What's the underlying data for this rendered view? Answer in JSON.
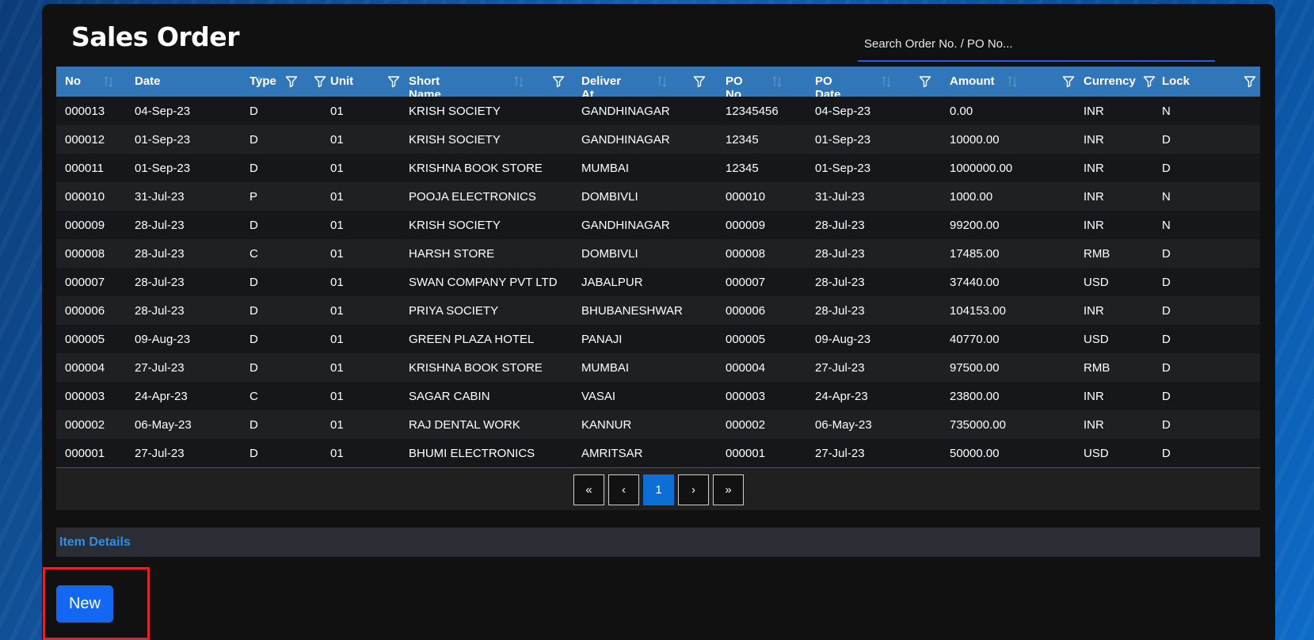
{
  "page": {
    "title": "Sales Order"
  },
  "search": {
    "placeholder": "Search Order No. / PO No..."
  },
  "table": {
    "columns": [
      {
        "key": "no",
        "label": "No",
        "sortable": true,
        "filterable": false
      },
      {
        "key": "date",
        "label": "Date",
        "sortable": true,
        "filterable": true
      },
      {
        "key": "type",
        "label": "Type",
        "sortable": false,
        "filterable": true
      },
      {
        "key": "unit",
        "label": "Unit",
        "sortable": false,
        "filterable": true
      },
      {
        "key": "short_name",
        "label": "Short Name",
        "sortable": true,
        "filterable": true
      },
      {
        "key": "deliver_at",
        "label": "Deliver At",
        "sortable": true,
        "filterable": true
      },
      {
        "key": "po_no",
        "label": "PO No",
        "sortable": true,
        "filterable": false
      },
      {
        "key": "po_date",
        "label": "PO Date",
        "sortable": true,
        "filterable": true
      },
      {
        "key": "amount",
        "label": "Amount",
        "sortable": true,
        "filterable": true
      },
      {
        "key": "currency",
        "label": "Currency",
        "sortable": false,
        "filterable": true
      },
      {
        "key": "lock",
        "label": "Lock",
        "sortable": false,
        "filterable": true
      }
    ],
    "rows": [
      [
        "000013",
        "04-Sep-23",
        "D",
        "01",
        "KRISH SOCIETY",
        "GANDHINAGAR",
        "12345456",
        "04-Sep-23",
        "0.00",
        "INR",
        "N"
      ],
      [
        "000012",
        "01-Sep-23",
        "D",
        "01",
        "KRISH SOCIETY",
        "GANDHINAGAR",
        "12345",
        "01-Sep-23",
        "10000.00",
        "INR",
        "D"
      ],
      [
        "000011",
        "01-Sep-23",
        "D",
        "01",
        "KRISHNA BOOK STORE",
        "MUMBAI",
        "12345",
        "01-Sep-23",
        "1000000.00",
        "INR",
        "D"
      ],
      [
        "000010",
        "31-Jul-23",
        "P",
        "01",
        "POOJA ELECTRONICS",
        "DOMBIVLI",
        "000010",
        "31-Jul-23",
        "1000.00",
        "INR",
        "N"
      ],
      [
        "000009",
        "28-Jul-23",
        "D",
        "01",
        "KRISH SOCIETY",
        "GANDHINAGAR",
        "000009",
        "28-Jul-23",
        "99200.00",
        "INR",
        "N"
      ],
      [
        "000008",
        "28-Jul-23",
        "C",
        "01",
        "HARSH STORE",
        "DOMBIVLI",
        "000008",
        "28-Jul-23",
        "17485.00",
        "RMB",
        "D"
      ],
      [
        "000007",
        "28-Jul-23",
        "D",
        "01",
        "SWAN COMPANY PVT LTD",
        "JABALPUR",
        "000007",
        "28-Jul-23",
        "37440.00",
        "USD",
        "D"
      ],
      [
        "000006",
        "28-Jul-23",
        "D",
        "01",
        "PRIYA SOCIETY",
        "BHUBANESHWAR",
        "000006",
        "28-Jul-23",
        "104153.00",
        "INR",
        "D"
      ],
      [
        "000005",
        "09-Aug-23",
        "D",
        "01",
        "GREEN PLAZA HOTEL",
        "PANAJI",
        "000005",
        "09-Aug-23",
        "40770.00",
        "USD",
        "D"
      ],
      [
        "000004",
        "27-Jul-23",
        "D",
        "01",
        "KRISHNA BOOK STORE",
        "MUMBAI",
        "000004",
        "27-Jul-23",
        "97500.00",
        "RMB",
        "D"
      ],
      [
        "000003",
        "24-Apr-23",
        "C",
        "01",
        "SAGAR CABIN",
        "VASAI",
        "000003",
        "24-Apr-23",
        "23800.00",
        "INR",
        "D"
      ],
      [
        "000002",
        "06-May-23",
        "D",
        "01",
        "RAJ DENTAL WORK",
        "KANNUR",
        "000002",
        "06-May-23",
        "735000.00",
        "INR",
        "D"
      ],
      [
        "000001",
        "27-Jul-23",
        "D",
        "01",
        "BHUMI ELECTRONICS",
        "AMRITSAR",
        "000001",
        "27-Jul-23",
        "50000.00",
        "USD",
        "D"
      ]
    ]
  },
  "pagination": {
    "first": "«",
    "prev": "‹",
    "current": "1",
    "next": "›",
    "last": "»"
  },
  "item_details": {
    "label": "Item Details"
  },
  "actions": {
    "new_label": "New"
  },
  "colors": {
    "header_bg": "#3176b8",
    "accent": "#1467f2",
    "highlight": "#e0242b",
    "link": "#2f8ee8"
  }
}
